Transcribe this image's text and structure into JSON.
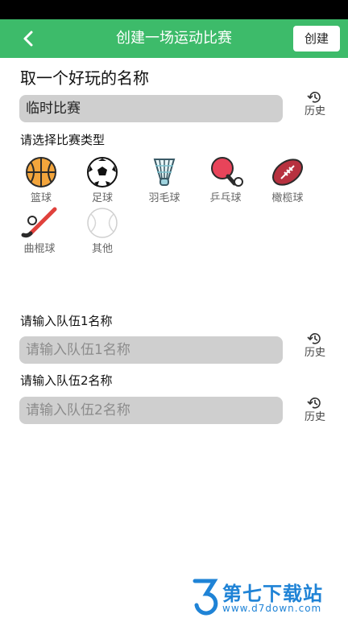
{
  "appbar": {
    "title": "创建一场运动比赛",
    "create_label": "创建"
  },
  "name_section": {
    "title": "取一个好玩的名称",
    "value": "临时比赛",
    "history_label": "历史"
  },
  "type_section": {
    "label": "请选择比赛类型",
    "sports": [
      {
        "name": "篮球",
        "icon": "basketball-icon"
      },
      {
        "name": "足球",
        "icon": "soccer-ball-icon"
      },
      {
        "name": "羽毛球",
        "icon": "shuttlecock-icon"
      },
      {
        "name": "乒乓球",
        "icon": "ping-pong-icon"
      },
      {
        "name": "橄榄球",
        "icon": "rugby-ball-icon"
      },
      {
        "name": "曲棍球",
        "icon": "hockey-stick-icon"
      },
      {
        "name": "其他",
        "icon": "other-ball-icon"
      }
    ]
  },
  "team1": {
    "label": "请输入队伍1名称",
    "placeholder": "请输入队伍1名称",
    "history_label": "历史"
  },
  "team2": {
    "label": "请输入队伍2名称",
    "placeholder": "请输入队伍2名称",
    "history_label": "历史"
  },
  "watermark": {
    "text": "第七下载站",
    "url": "www.d7down.com"
  },
  "colors": {
    "accent": "#3dbb6a",
    "field_bg": "#cfcfcf"
  }
}
